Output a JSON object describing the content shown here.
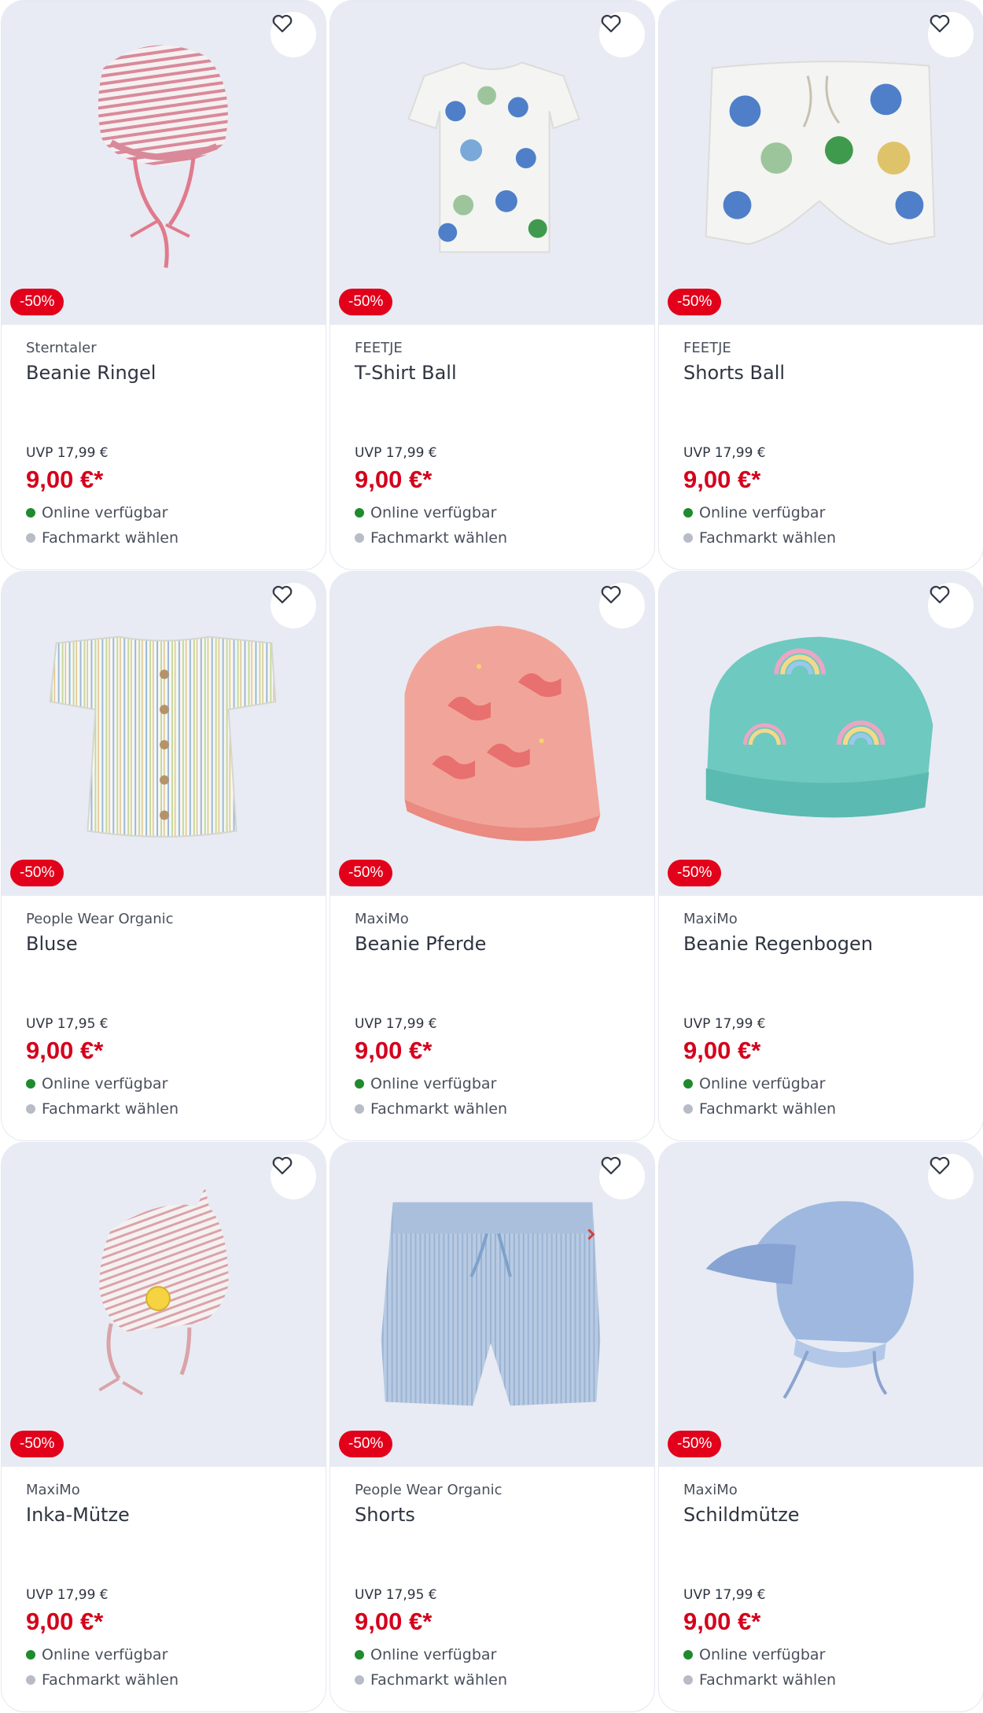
{
  "products": [
    {
      "brand": "Sterntaler",
      "title": "Beanie Ringel",
      "uvp": "UVP 17,99 €",
      "price": "9,00 €*",
      "badge": "-50%",
      "availability": "Online verfügbar",
      "store": "Fachmarkt wählen",
      "image": "striped-bonnet"
    },
    {
      "brand": "FEETJE",
      "title": "T-Shirt Ball",
      "uvp": "UVP 17,99 €",
      "price": "9,00 €*",
      "badge": "-50%",
      "availability": "Online verfügbar",
      "store": "Fachmarkt wählen",
      "image": "ball-tshirt"
    },
    {
      "brand": "FEETJE",
      "title": "Shorts Ball",
      "uvp": "UVP 17,99 €",
      "price": "9,00 €*",
      "badge": "-50%",
      "availability": "Online verfügbar",
      "store": "Fachmarkt wählen",
      "image": "ball-shorts"
    },
    {
      "brand": "People Wear Organic",
      "title": "Bluse",
      "uvp": "UVP 17,95 €",
      "price": "9,00 €*",
      "badge": "-50%",
      "availability": "Online verfügbar",
      "store": "Fachmarkt wählen",
      "image": "striped-blouse"
    },
    {
      "brand": "MaxiMo",
      "title": "Beanie Pferde",
      "uvp": "UVP 17,99 €",
      "price": "9,00 €*",
      "badge": "-50%",
      "availability": "Online verfügbar",
      "store": "Fachmarkt wählen",
      "image": "horse-beanie"
    },
    {
      "brand": "MaxiMo",
      "title": "Beanie Regenbogen",
      "uvp": "UVP 17,99 €",
      "price": "9,00 €*",
      "badge": "-50%",
      "availability": "Online verfügbar",
      "store": "Fachmarkt wählen",
      "image": "rainbow-beanie"
    },
    {
      "brand": "MaxiMo",
      "title": "Inka-Mütze",
      "uvp": "UVP 17,99 €",
      "price": "9,00 €*",
      "badge": "-50%",
      "availability": "Online verfügbar",
      "store": "Fachmarkt wählen",
      "image": "inka-hat"
    },
    {
      "brand": "People Wear Organic",
      "title": "Shorts",
      "uvp": "UVP 17,95 €",
      "price": "9,00 €*",
      "badge": "-50%",
      "availability": "Online verfügbar",
      "store": "Fachmarkt wählen",
      "image": "striped-shorts"
    },
    {
      "brand": "MaxiMo",
      "title": "Schildmütze",
      "uvp": "UVP 17,99 €",
      "price": "9,00 €*",
      "badge": "-50%",
      "availability": "Online verfügbar",
      "store": "Fachmarkt wählen",
      "image": "peaked-cap"
    }
  ],
  "icons": {
    "favorite": "heart-outline-icon",
    "available": "green-dot-icon",
    "store": "grey-dot-icon"
  },
  "colors": {
    "discount": "#e2001a",
    "price": "#d4001c",
    "available": "#1f8a2e",
    "image_bg": "#e8ebf3"
  }
}
